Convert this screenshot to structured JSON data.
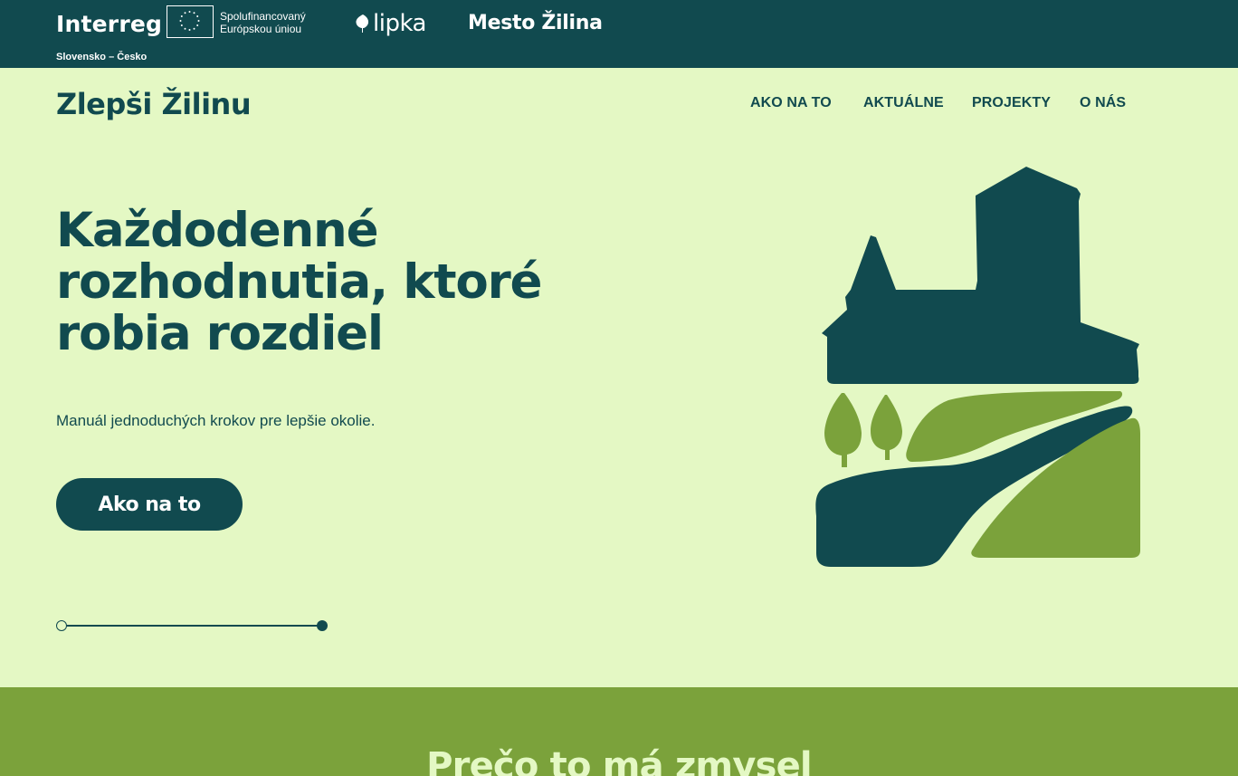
{
  "sponsors": {
    "interreg": "Interreg",
    "eu_line1": "Spolufinancovaný",
    "eu_line2": "Európskou úniou",
    "region": "Slovensko – Česko",
    "lipka": "lipka",
    "mesto": "Mesto Žilina"
  },
  "header": {
    "brand": "Zlepši Žilinu",
    "nav": [
      "AKO NA TO",
      "AKTUÁLNE",
      "PROJEKTY",
      "O NÁS"
    ]
  },
  "hero": {
    "title_line1": "Každodenné",
    "title_line2": "rozhodnutia, ktoré",
    "title_line3": "robia rozdiel",
    "subtitle": "Manuál jednoduchých krokov pre lepšie okolie.",
    "cta_label": "Ako na to"
  },
  "section": {
    "title": "Prečo to má zmysel"
  },
  "colors": {
    "dark_teal": "#114a4f",
    "light_green_bg": "#e4f8c4",
    "olive_green": "#7ba23b"
  }
}
